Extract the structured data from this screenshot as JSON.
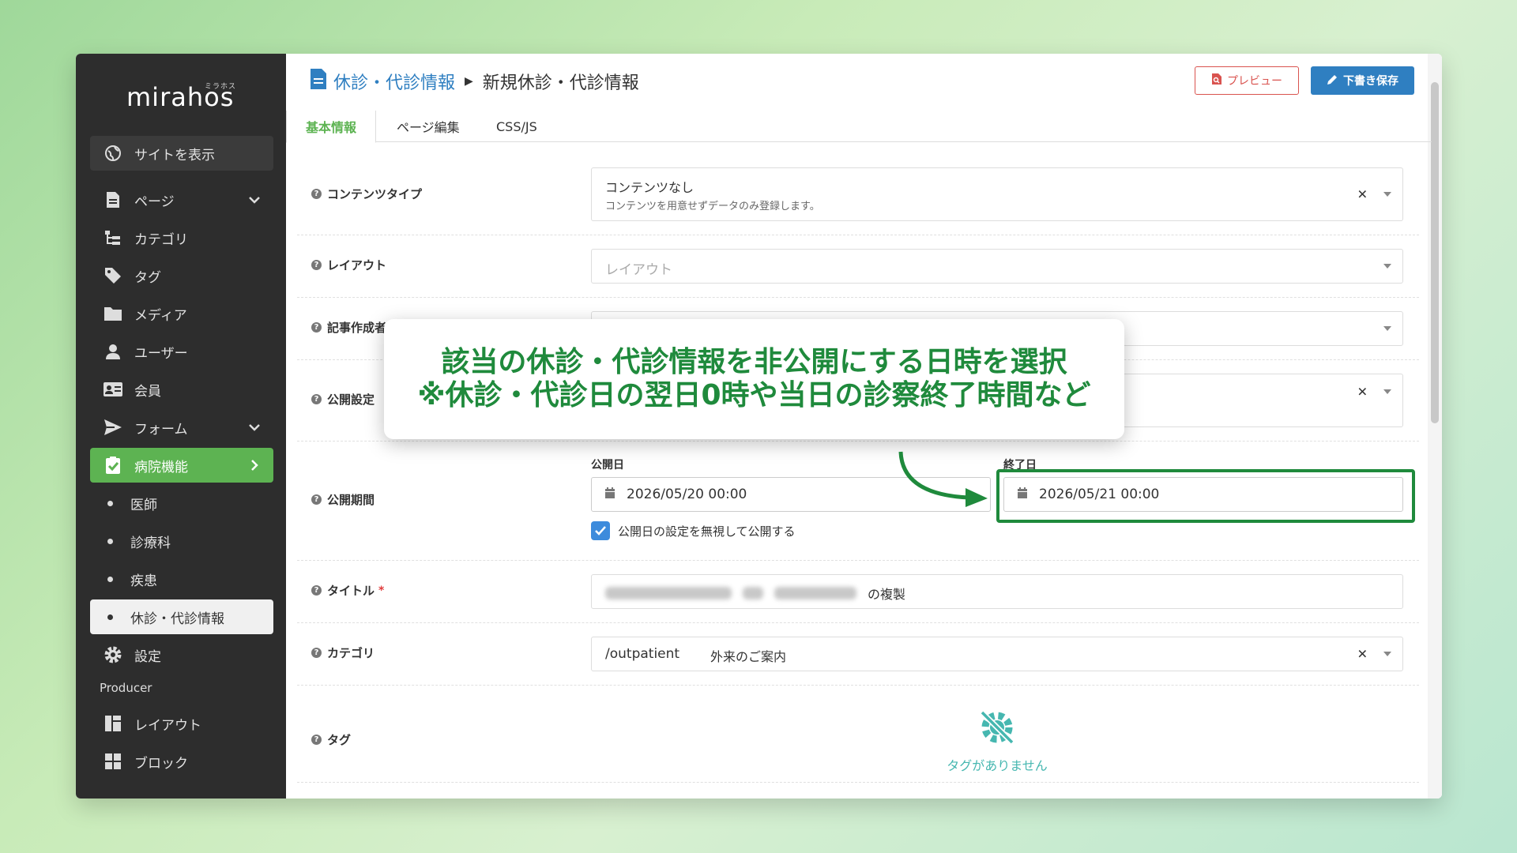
{
  "sidebar": {
    "logo": "mirahos",
    "logo_kana": "ミラホス",
    "view_site": "サイトを表示",
    "items": [
      {
        "label": "ページ"
      },
      {
        "label": "カテゴリ"
      },
      {
        "label": "タグ"
      },
      {
        "label": "メディア"
      },
      {
        "label": "ユーザー"
      },
      {
        "label": "会員"
      },
      {
        "label": "フォーム"
      },
      {
        "label": "病院機能"
      },
      {
        "label": "医師"
      },
      {
        "label": "診療科"
      },
      {
        "label": "疾患"
      },
      {
        "label": "休診・代診情報"
      },
      {
        "label": "設定"
      }
    ],
    "producer_label": "Producer",
    "producer_items": [
      {
        "label": "レイアウト"
      },
      {
        "label": "ブロック"
      }
    ]
  },
  "breadcrumb": {
    "parent": "休診・代診情報",
    "current": "新規休診・代診情報"
  },
  "actions": {
    "preview": "プレビュー",
    "draft_save": "下書き保存"
  },
  "tabs": [
    "基本情報",
    "ページ編集",
    "CSS/JS"
  ],
  "form": {
    "content_type": {
      "label": "コンテンツタイプ",
      "value": "コンテンツなし",
      "description": "コンテンツを用意せずデータのみ登録します。"
    },
    "layout": {
      "label": "レイアウト",
      "placeholder": "レイアウト"
    },
    "author": {
      "label": "記事作成者"
    },
    "publish_setting": {
      "label": "公開設定"
    },
    "publish_period": {
      "label": "公開期間",
      "start_label": "公開日",
      "start_value": "2026/05/20 00:00",
      "end_label": "終了日",
      "end_value": "2026/05/21 00:00",
      "ignore_checkbox_label": "公開日の設定を無視して公開する",
      "ignore_checked": true
    },
    "title": {
      "label": "タイトル",
      "required_mark": "*",
      "suffix": "の複製"
    },
    "category": {
      "label": "カテゴリ",
      "slug": "/outpatient",
      "name": "外来のご案内"
    },
    "tags": {
      "label": "タグ",
      "empty_message": "タグがありません"
    }
  },
  "callout": {
    "line1": "該当の休診・代診情報を非公開にする日時を選択",
    "line2": "※休診・代診日の翌日0時や当日の診察終了時間など",
    "color": "#1f8a3c"
  },
  "colors": {
    "sidebar_bg": "#2d2d2d",
    "accent_green": "#5db352",
    "link_blue": "#2f7fc1",
    "preview_red": "#d9534f"
  }
}
